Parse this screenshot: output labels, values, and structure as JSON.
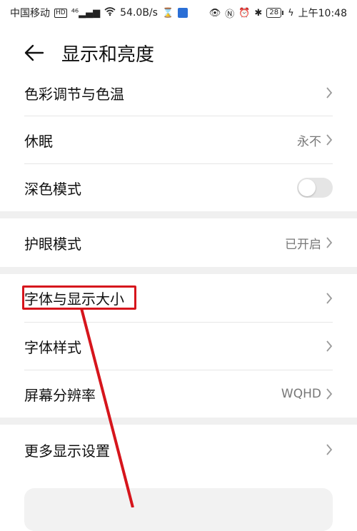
{
  "status_bar": {
    "carrier": "中国移动",
    "hd": "HD",
    "network": "⁴⁶",
    "speed": "54.0B/s",
    "battery": "28",
    "time": "上午10:48"
  },
  "header": {
    "title": "显示和亮度"
  },
  "settings": {
    "color_temp": {
      "label": "色彩调节与色温"
    },
    "sleep": {
      "label": "休眠",
      "value": "永不"
    },
    "dark_mode": {
      "label": "深色模式",
      "enabled": false
    },
    "eye_comfort": {
      "label": "护眼模式",
      "value": "已开启"
    },
    "font_display_size": {
      "label": "字体与显示大小"
    },
    "font_style": {
      "label": "字体样式"
    },
    "resolution": {
      "label": "屏幕分辨率",
      "value": "WQHD"
    },
    "more_display": {
      "label": "更多显示设置"
    }
  },
  "colors": {
    "annotation": "#d6151c",
    "toggle_off": "#e5e5e5",
    "section_gap": "#f0f0f0"
  }
}
